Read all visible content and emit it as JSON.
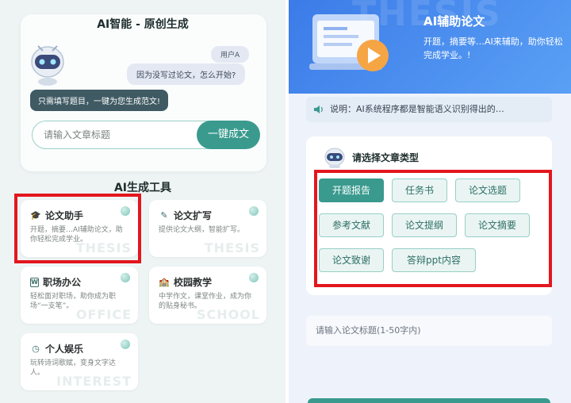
{
  "left": {
    "card_title": "AI智能 - 原创生成",
    "user_label": "用户A",
    "question": "因为没写过论文，怎么开始?",
    "answer": "只需填写题目，一键为您生成范文!",
    "input_placeholder": "请输入文章标题",
    "generate_button": "一键成文",
    "tools_title": "AI生成工具",
    "tools": [
      {
        "title": "论文助手",
        "desc": "开题，摘要…AI辅助论文，助你轻松完成学业。",
        "watermark": "THESIS",
        "icon": "graduation-cap-icon"
      },
      {
        "title": "论文扩写",
        "desc": "提供论文大纲，智能扩写。",
        "watermark": "THESIS",
        "icon": "pen-write-icon"
      },
      {
        "title": "职场办公",
        "desc": "轻松面对职场，助你成为职场“一支笔”。",
        "watermark": "OFFICE",
        "icon": "word-doc-icon"
      },
      {
        "title": "校园教学",
        "desc": "中学作文，课堂作业，成为你的贴身秘书。",
        "watermark": "SCHOOL",
        "icon": "school-building-icon"
      },
      {
        "title": "个人娱乐",
        "desc": "玩转诗词歌赋，变身文字达人。",
        "watermark": "INTEREST",
        "icon": "entertainment-icon"
      }
    ]
  },
  "right": {
    "hero_watermark": "THESIS",
    "hero_title": "AI辅助论文",
    "hero_subtitle": "开题，摘要等…AI来辅助，助你轻松完成学业。!",
    "notice": "说明：AI系统程序都是智能语义识别得出的…",
    "type_title": "请选择文章类型",
    "types": [
      "开题报告",
      "任务书",
      "论文选题",
      "参考文献",
      "论文提纲",
      "论文摘要",
      "论文致谢",
      "答辩ppt内容"
    ],
    "active_type": "开题报告",
    "title_placeholder": "请输入论文标题(1-50字内)"
  },
  "colors": {
    "teal": "#3a9a8e",
    "highlight_red": "#e3161e",
    "hero_blue": "#3b7be8"
  }
}
